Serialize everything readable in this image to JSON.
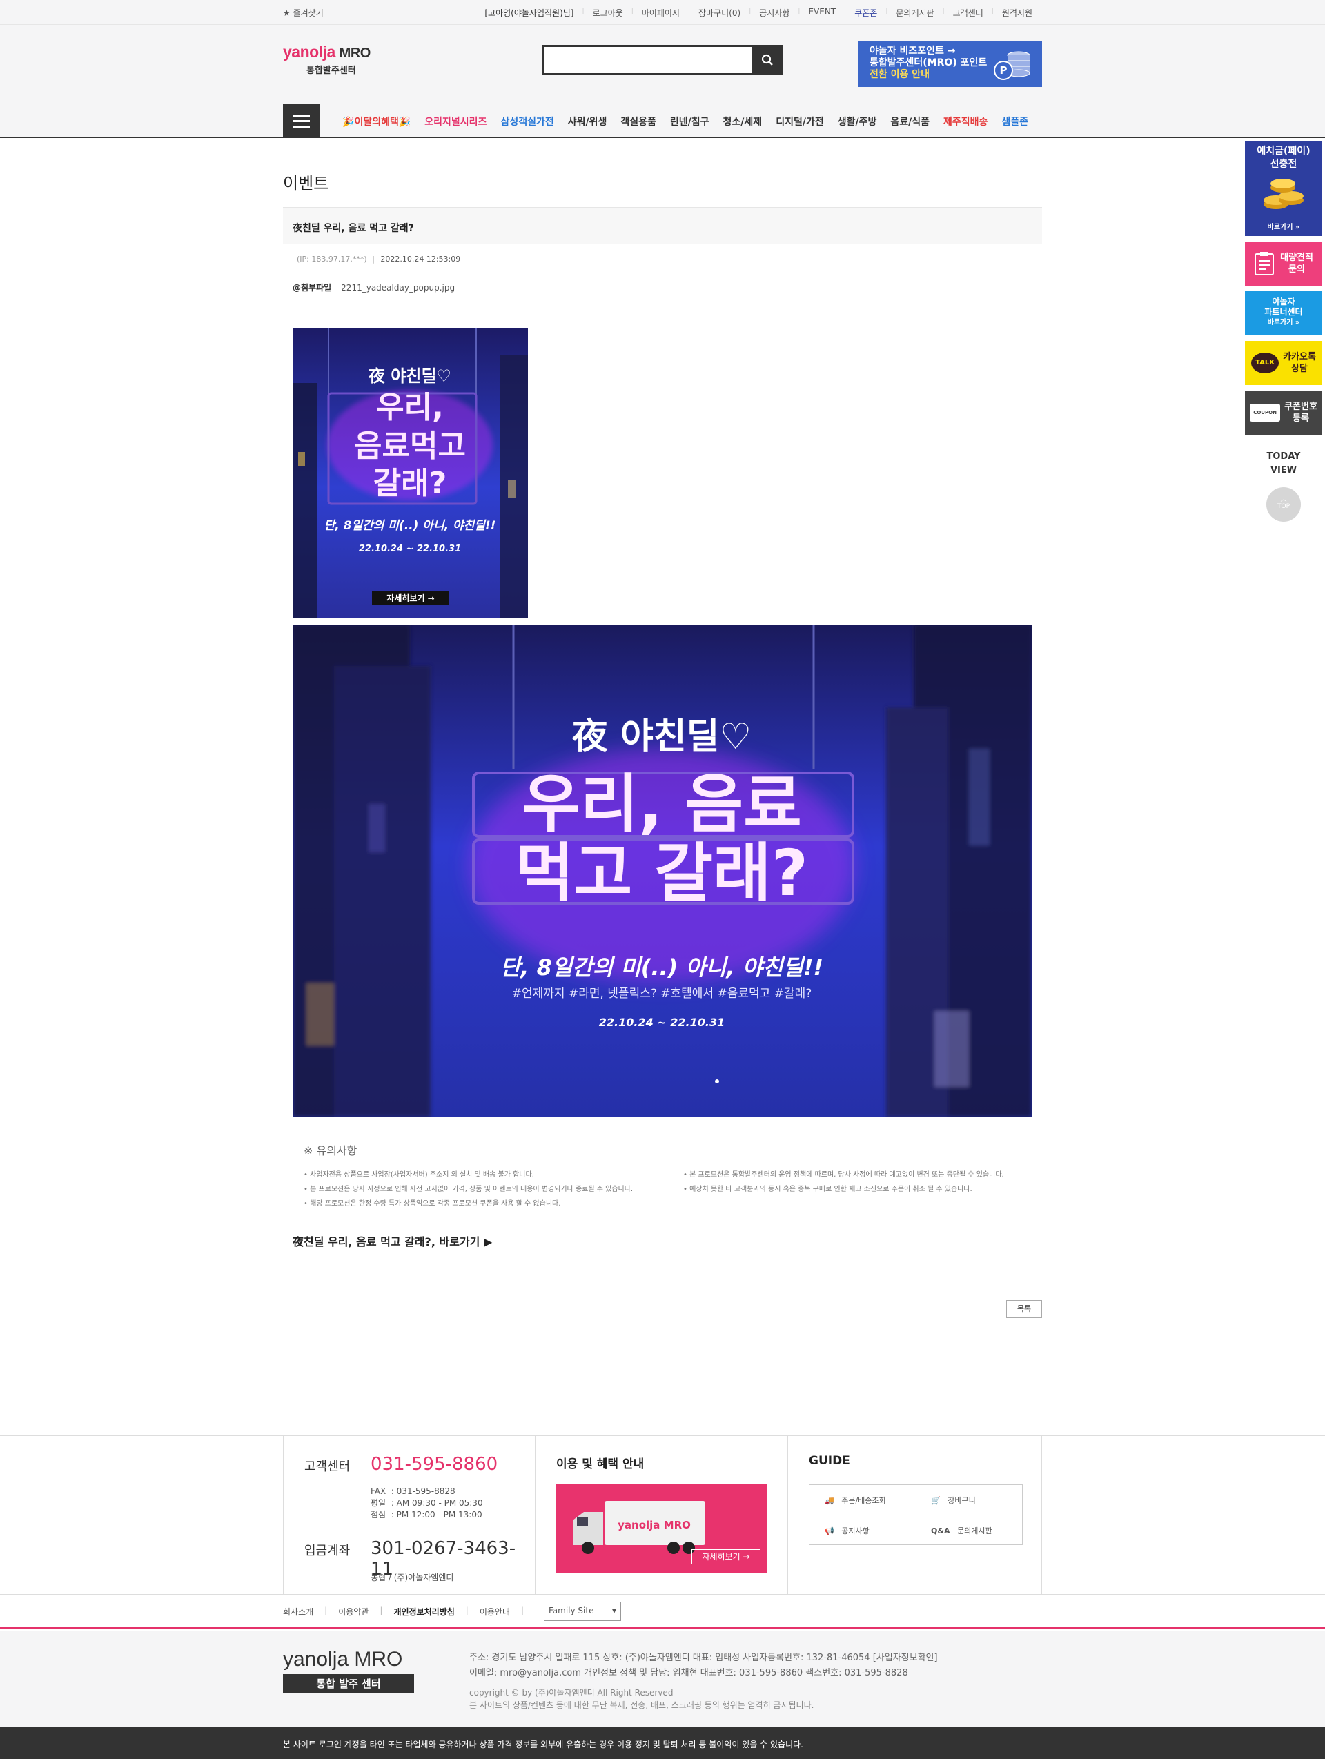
{
  "topbar": {
    "bookmark": "★ 즐겨찾기",
    "user": "[고아영(야놀자임직원)님]",
    "links": [
      "로그아웃",
      "마이페이지",
      "장바구니(0)",
      "공지사항",
      "EVENT",
      "쿠폰존",
      "문의게시판",
      "고객센터",
      "원격지원"
    ]
  },
  "header": {
    "logo_brand": "yanolja",
    "logo_mro": "MRO",
    "logo_sub": "통합발주센터",
    "search_placeholder": "",
    "banner_l1": "야놀자 비즈포인트 →",
    "banner_l2": "통합발주센터(MRO) 포인트",
    "banner_l3": "전환 이용 안내"
  },
  "gnb": {
    "items": [
      "이달의혜택",
      "오리지널시리즈",
      "삼성객실가전",
      "샤워/위생",
      "객실용품",
      "린넨/침구",
      "청소/세제",
      "디지털/가전",
      "생활/주방",
      "음료/식품",
      "제주직배송",
      "샘플존"
    ]
  },
  "page": {
    "title": "이벤트",
    "subject": "夜친딜 우리, 음료 먹고 갈래?",
    "ip": "(IP: 183.97.17.***)",
    "date": "2022.10.24 12:53:09",
    "attach_label": "첨부파일",
    "attach_file": "2211_yadealday_popup.jpg"
  },
  "promo": {
    "brand": "夜 야친딜♡",
    "headline1": "우리, 음료",
    "headline2": "먹고 갈래?",
    "headline_s1": "우리,",
    "headline_s2": "음료먹고",
    "headline_s3": "갈래?",
    "sub": "단, 8일간의 미(..) 아니, 야친딜!!",
    "tags": "#언제까지 #라면, 넷플릭스? #호텔에서 #음료먹고 #갈래?",
    "period": "22.10.24 ~ 22.10.31",
    "more": "자세히보기 →"
  },
  "notice": {
    "title": "※ 유의사항",
    "left": [
      "• 사업자전용 상품으로 사업장(사업자서버) 주소지 외 설치 및 배송 불가 합니다.",
      "• 본 프로모션은 당사 사정으로 인해 사전 고지없이 가격, 상품 및 이벤트의 내용이 변경되거나 종료될 수 있습니다.",
      "• 해당 프로모션은 한정 수량 특가 상품임으로 각종 프로모션 쿠폰을 사용 할 수 없습니다."
    ],
    "right": [
      "• 본 프로모션은 통합발주센터의 운영 정책에 따르며, 당사 사정에 따라 예고없이 변경 또는 중단될 수 있습니다.",
      "• 예상치 못한 타 고객분과의 동시 혹은 중복 구매로 인한 재고 소진으로 주문이 취소 될 수 있습니다."
    ]
  },
  "shortcut": "夜친딜 우리, 음료 먹고 갈래?, 바로가기 ▶",
  "list_button": "목록",
  "quick": {
    "deposit1": "예치금(페이)",
    "deposit2": "선충전",
    "deposit_go": "바로가기 »",
    "bulk1": "대량견적",
    "bulk2": "문의",
    "partner1": "야놀자",
    "partner2": "파트너센터",
    "partner_go": "바로가기 »",
    "kakao1": "카카오톡",
    "kakao2": "상담",
    "kakao_icon": "TALK",
    "coupon1": "쿠폰번호",
    "coupon2": "등록",
    "coupon_icon": "COUPON",
    "today1": "TODAY",
    "today2": "VIEW",
    "top": "TOP"
  },
  "footer": {
    "cs_label": "고객센터",
    "cs_phone": "031-595-8860",
    "fax_k": "FAX",
    "fax_v": "031-595-8828",
    "wd_k": "평일",
    "wd_v": "AM 09:30 - PM 05:30",
    "lunch_k": "점심",
    "lunch_v": "PM 12:00 - PM 13:00",
    "acct_label": "입금계좌",
    "acct_no": "301-0267-3463-11",
    "acct_bank": "농협 / (주)야놀자엠엔디",
    "benefit_title": "이용 및 혜택 안내",
    "truck_brand": "yanolja MRO",
    "benefit_more": "자세히보기 →",
    "guide_title": "GUIDE",
    "guide": [
      "주문/배송조회",
      "장바구니",
      "공지사항",
      "문의게시판"
    ],
    "guide_qa": "Q&A"
  },
  "flinks": {
    "items": [
      "회사소개",
      "이용약관",
      "개인정보처리방침",
      "이용안내"
    ],
    "family": "Family Site"
  },
  "bottom": {
    "logo": "yanolja MRO",
    "logo_sub": "통합 발주 센터",
    "line1": "주소: 경기도 남양주시 일패로 115    상호: (주)야놀자엠엔디    대표: 임태성    사업자등록번호: 132-81-46054 [사업자정보확인]",
    "line2": "이메일: mro@yanolja.com    개인정보 정책 및 담당: 임채현    대표번호: 031-595-8860    팩스번호: 031-595-8828",
    "line3": "copyright © by (주)야놀자엠엔디 All Right Reserved",
    "line4": "본 사이트의 상품/컨텐츠 등에 대한 무단 복제, 전송, 배포, 스크래핑 등의 행위는 엄격히 금지됩니다.",
    "warning": "본 사이트 로그인 계정을 타인 또는 타업체와 공유하거나 상품 가격 정보를 외부에 유출하는 경우 이용 정지 및 탈퇴 처리 등 불이익이 있을 수 있습니다."
  },
  "colors": {
    "brand_pink": "#e5336b",
    "dark": "#333333",
    "banner_blue": "#3b66c9",
    "deposit_navy": "#2d3e9f",
    "kakao_yellow": "#fae100"
  }
}
